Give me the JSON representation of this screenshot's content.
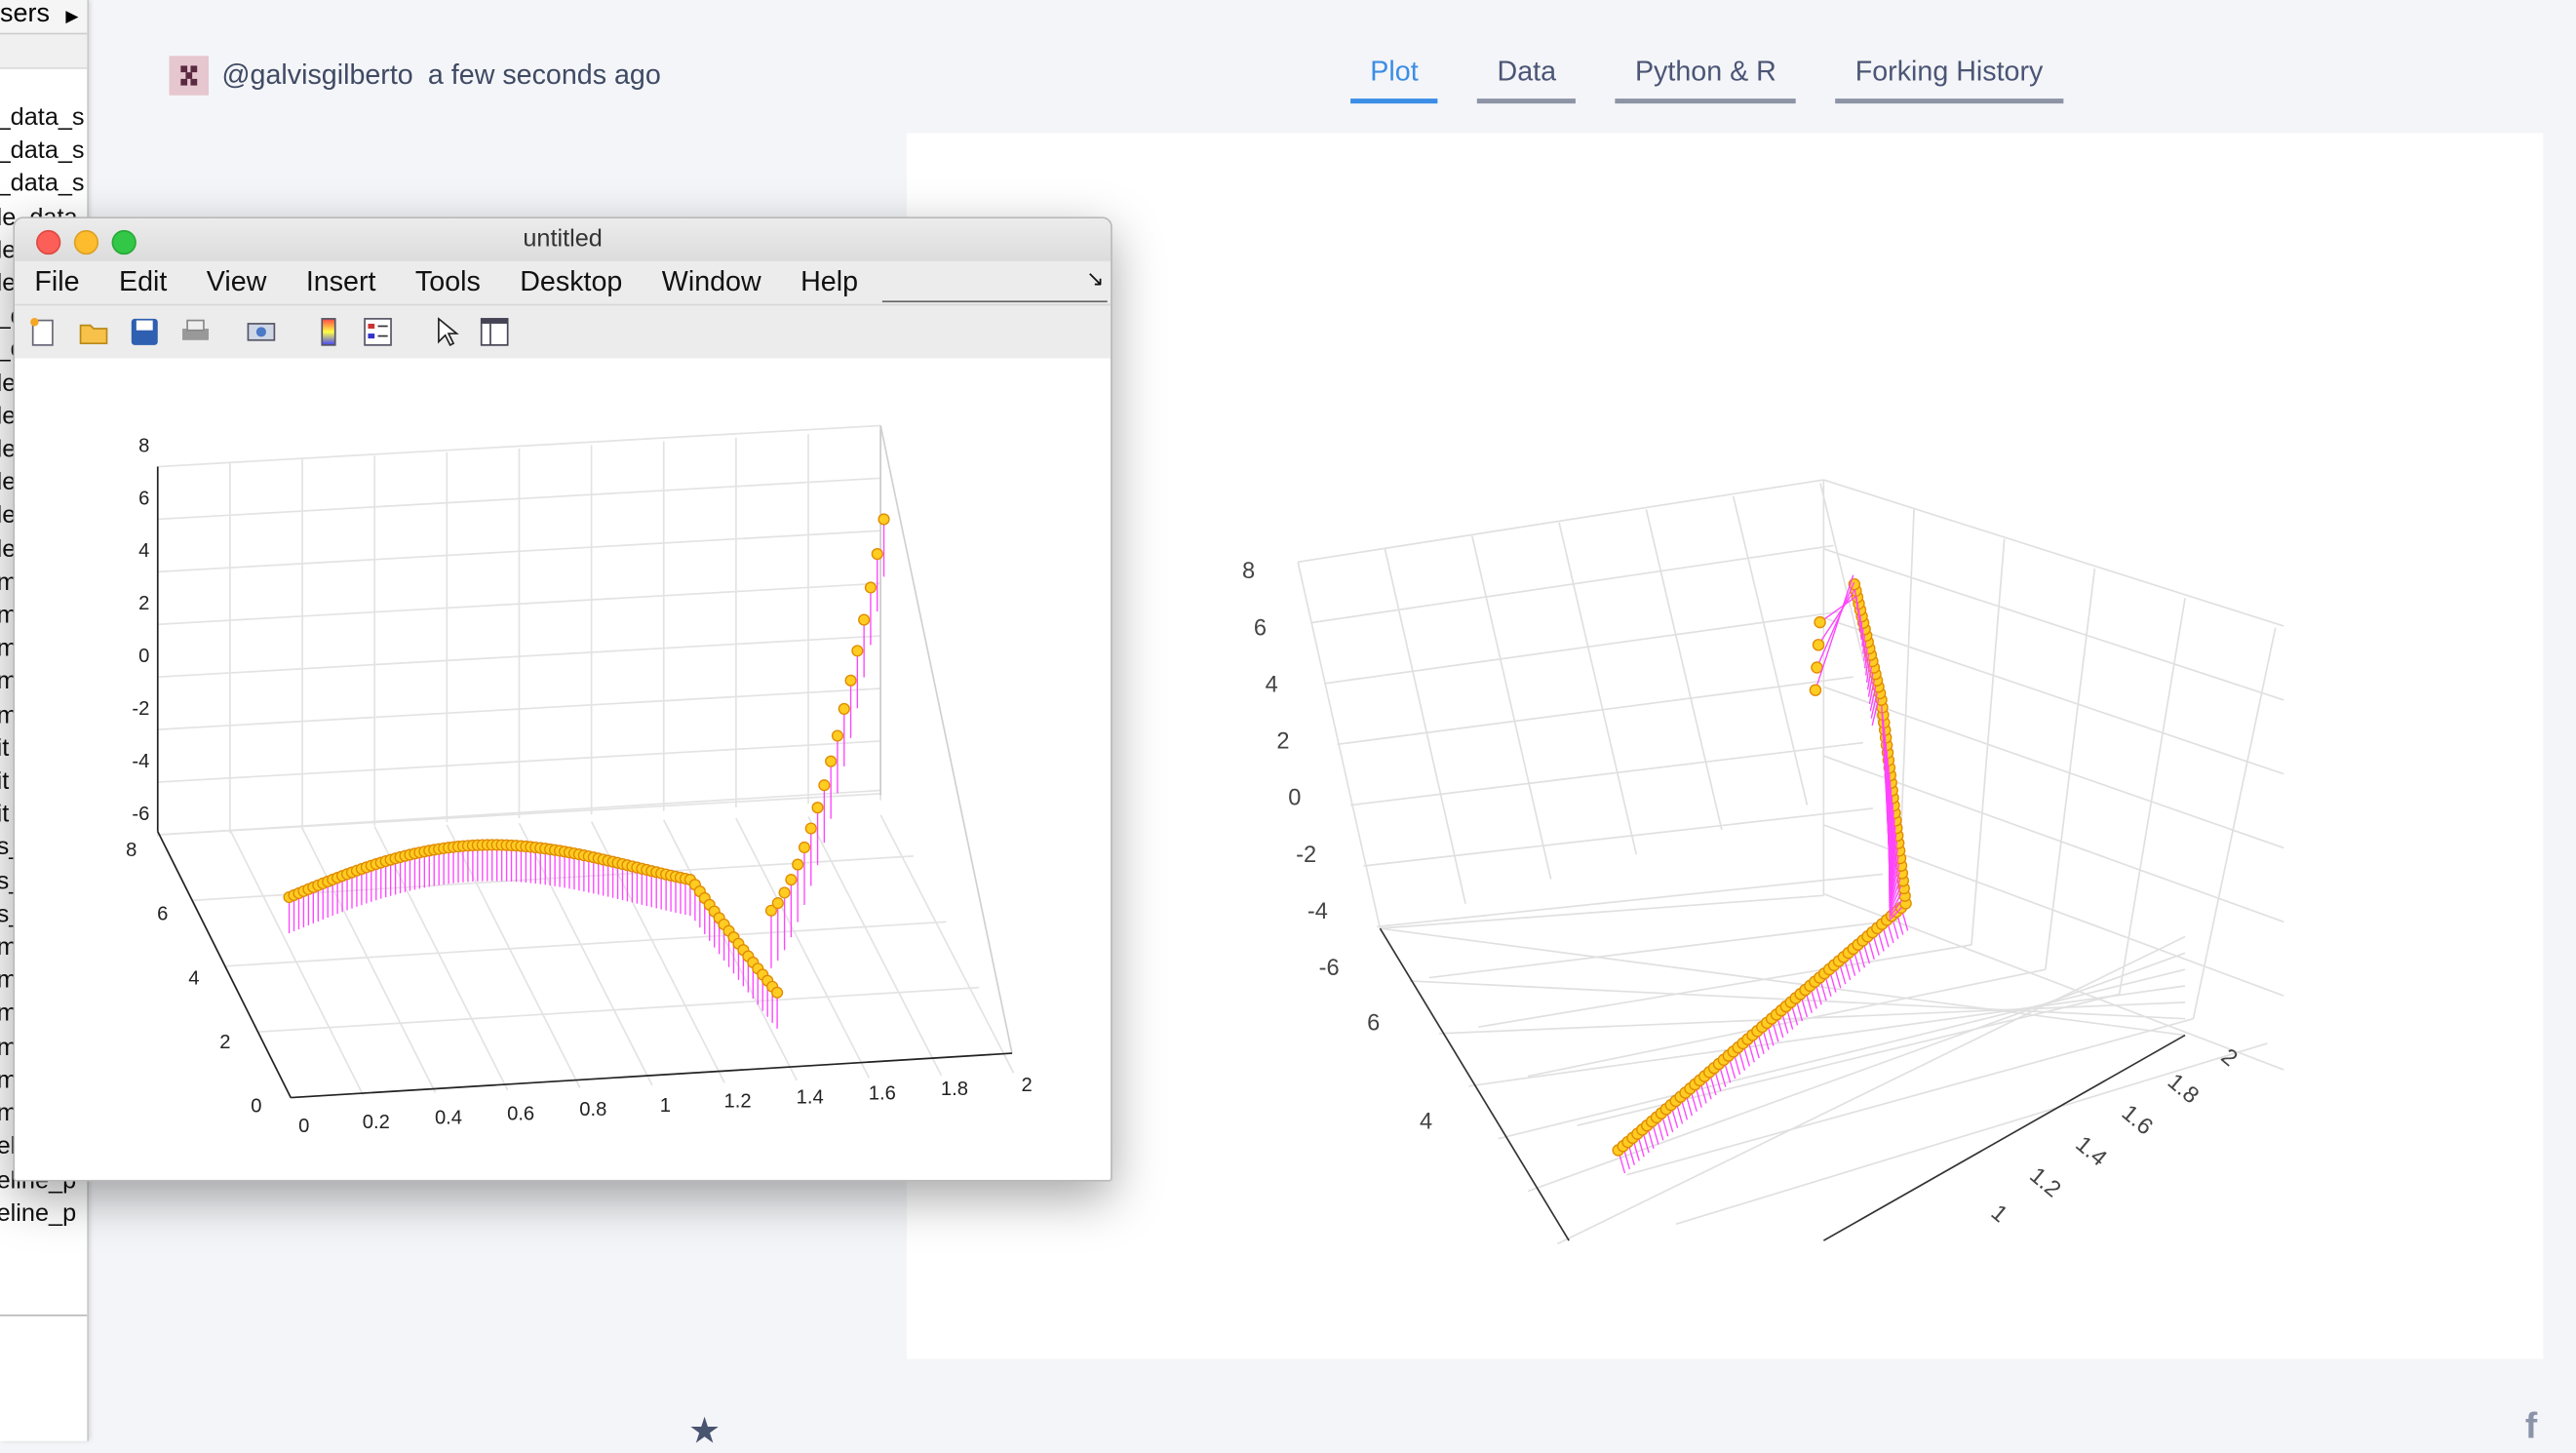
{
  "file_browser": {
    "breadcrumb": "sers",
    "items": [
      "_data_s",
      "_data_s",
      "_data_s",
      "le_data",
      "le",
      "le",
      "_d",
      "_d",
      "le",
      "le",
      "le",
      "le",
      "le",
      "le",
      "m",
      "m",
      "m",
      "m",
      "m",
      "it",
      "it",
      "it",
      "s_",
      "s_",
      "s_",
      "m",
      "m",
      "m",
      "m",
      "m",
      "m_serie",
      "eline_p",
      "eline_p",
      "eline_p"
    ]
  },
  "header": {
    "username": "@galvisgilberto",
    "timestamp": "a few seconds ago",
    "tabs": [
      {
        "label": "Plot",
        "active": true
      },
      {
        "label": "Data",
        "active": false
      },
      {
        "label": "Python & R",
        "active": false
      },
      {
        "label": "Forking History",
        "active": false
      }
    ]
  },
  "matlab": {
    "title": "untitled",
    "menu": [
      "File",
      "Edit",
      "View",
      "Insert",
      "Tools",
      "Desktop",
      "Window",
      "Help"
    ],
    "toolbar_icons": [
      "new-figure-icon",
      "open-icon",
      "save-icon",
      "print-icon",
      "link-icon",
      "colorbar-icon",
      "legend-icon",
      "pointer-icon",
      "property-inspector-icon"
    ]
  },
  "footer": {
    "star_icon": "star-icon",
    "social_icon": "facebook-icon",
    "social_glyph": "f"
  },
  "chart_data": [
    {
      "type": "stem3",
      "view": "matlab",
      "x_ticks": [
        "0",
        "0.2",
        "0.4",
        "0.6",
        "0.8",
        "1",
        "1.2",
        "1.4",
        "1.6",
        "1.8",
        "2"
      ],
      "y_ticks": [
        "0",
        "2",
        "4",
        "6",
        "8"
      ],
      "z_ticks": [
        "8",
        "6",
        "4",
        "2",
        "0",
        "-2",
        "-4",
        "-6"
      ],
      "marker_color": "#ffcc22",
      "stem_color": "#ff44ff",
      "series": [
        {
          "x_range": [
            0,
            2
          ],
          "z_min": -6,
          "z_max": 7
        }
      ]
    },
    {
      "type": "stem3",
      "view": "plotly",
      "x_ticks": [
        "1",
        "1.2",
        "1.4",
        "1.6",
        "1.8",
        "2"
      ],
      "y_ticks": [
        "4",
        "6"
      ],
      "z_ticks": [
        "8",
        "6",
        "4",
        "2",
        "0",
        "-2",
        "-4",
        "-6"
      ],
      "marker_color": "#ffcc22",
      "stem_color": "#ff44ff"
    }
  ]
}
